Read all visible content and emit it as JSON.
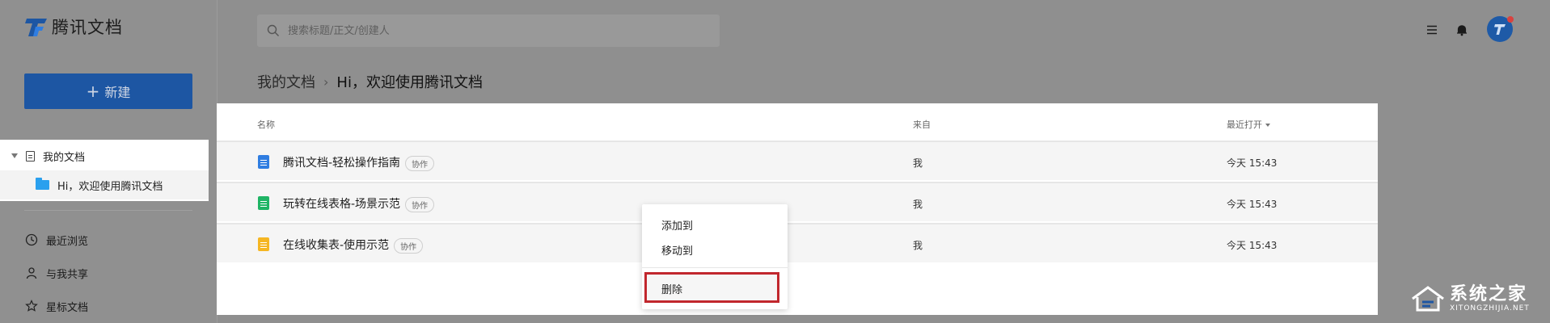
{
  "app": {
    "name": "腾讯文档"
  },
  "sidebar": {
    "new_button": "新建",
    "tree": {
      "root": "我的文档",
      "child": "Hi，欢迎使用腾讯文档"
    },
    "nav": [
      {
        "label": "最近浏览",
        "icon": "clock-icon"
      },
      {
        "label": "与我共享",
        "icon": "user-icon"
      },
      {
        "label": "星标文档",
        "icon": "star-icon"
      }
    ]
  },
  "search": {
    "placeholder": "搜索标题/正文/创建人"
  },
  "breadcrumb": {
    "root": "我的文档",
    "current": "Hi，欢迎使用腾讯文档"
  },
  "list": {
    "headers": {
      "name": "名称",
      "source": "来自",
      "recent": "最近打开"
    },
    "rows": [
      {
        "name": "腾讯文档-轻松操作指南",
        "badge": "协作",
        "owner": "我",
        "time": "今天 15:43",
        "icon": "doc-icon",
        "color": "#2f7de1"
      },
      {
        "name": "玩转在线表格-场景示范",
        "badge": "协作",
        "owner": "我",
        "time": "今天 15:43",
        "icon": "sheet-icon",
        "color": "#1fb465"
      },
      {
        "name": "在线收集表-使用示范",
        "badge": "协作",
        "owner": "我",
        "time": "今天 15:43",
        "icon": "form-icon",
        "color": "#f5b623"
      }
    ]
  },
  "context_menu": {
    "add_to": "添加到",
    "move_to": "移动到",
    "delete": "删除"
  },
  "watermark": {
    "cn": "系统之家",
    "en": "XITONGZHIJIA.NET"
  },
  "colors": {
    "brand": "#1d56a3",
    "highlight": "#c1272d"
  }
}
